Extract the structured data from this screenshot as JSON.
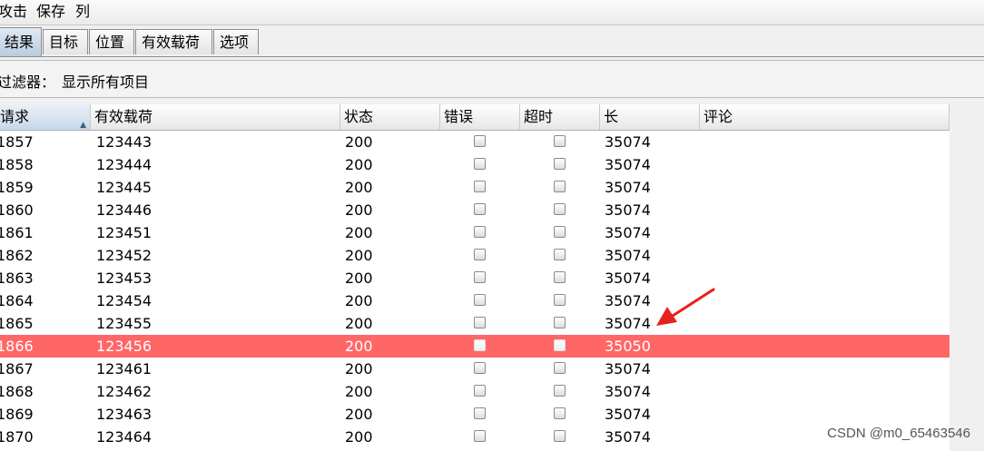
{
  "menu": {
    "items": [
      "攻击",
      "保存",
      "列"
    ]
  },
  "tabs": [
    "结果",
    "目标",
    "位置",
    "有效载荷",
    "选项"
  ],
  "filter": {
    "label": "过滤器：",
    "value": "显示所有项目"
  },
  "table": {
    "columns": [
      "请求",
      "有效载荷",
      "状态",
      "错误",
      "超时",
      "长",
      "评论"
    ],
    "sorted_column": "请求",
    "sort_direction": "ascending",
    "rows": [
      {
        "request": "1857",
        "payload": "123443",
        "status": "200",
        "length": "35074",
        "comment": "",
        "highlight": false
      },
      {
        "request": "1858",
        "payload": "123444",
        "status": "200",
        "length": "35074",
        "comment": "",
        "highlight": false
      },
      {
        "request": "1859",
        "payload": "123445",
        "status": "200",
        "length": "35074",
        "comment": "",
        "highlight": false
      },
      {
        "request": "1860",
        "payload": "123446",
        "status": "200",
        "length": "35074",
        "comment": "",
        "highlight": false
      },
      {
        "request": "1861",
        "payload": "123451",
        "status": "200",
        "length": "35074",
        "comment": "",
        "highlight": false
      },
      {
        "request": "1862",
        "payload": "123452",
        "status": "200",
        "length": "35074",
        "comment": "",
        "highlight": false
      },
      {
        "request": "1863",
        "payload": "123453",
        "status": "200",
        "length": "35074",
        "comment": "",
        "highlight": false
      },
      {
        "request": "1864",
        "payload": "123454",
        "status": "200",
        "length": "35074",
        "comment": "",
        "highlight": false
      },
      {
        "request": "1865",
        "payload": "123455",
        "status": "200",
        "length": "35074",
        "comment": "",
        "highlight": false
      },
      {
        "request": "1866",
        "payload": "123456",
        "status": "200",
        "length": "35050",
        "comment": "",
        "highlight": true
      },
      {
        "request": "1867",
        "payload": "123461",
        "status": "200",
        "length": "35074",
        "comment": "",
        "highlight": false
      },
      {
        "request": "1868",
        "payload": "123462",
        "status": "200",
        "length": "35074",
        "comment": "",
        "highlight": false
      },
      {
        "request": "1869",
        "payload": "123463",
        "status": "200",
        "length": "35074",
        "comment": "",
        "highlight": false
      },
      {
        "request": "1870",
        "payload": "123464",
        "status": "200",
        "length": "35074",
        "comment": "",
        "highlight": false
      }
    ]
  },
  "colors": {
    "highlight_row": "#ff6666",
    "annotation_arrow": "#e8211d"
  },
  "annotation": {
    "icon": "red-arrow-icon"
  },
  "watermark": "CSDN @m0_65463546"
}
